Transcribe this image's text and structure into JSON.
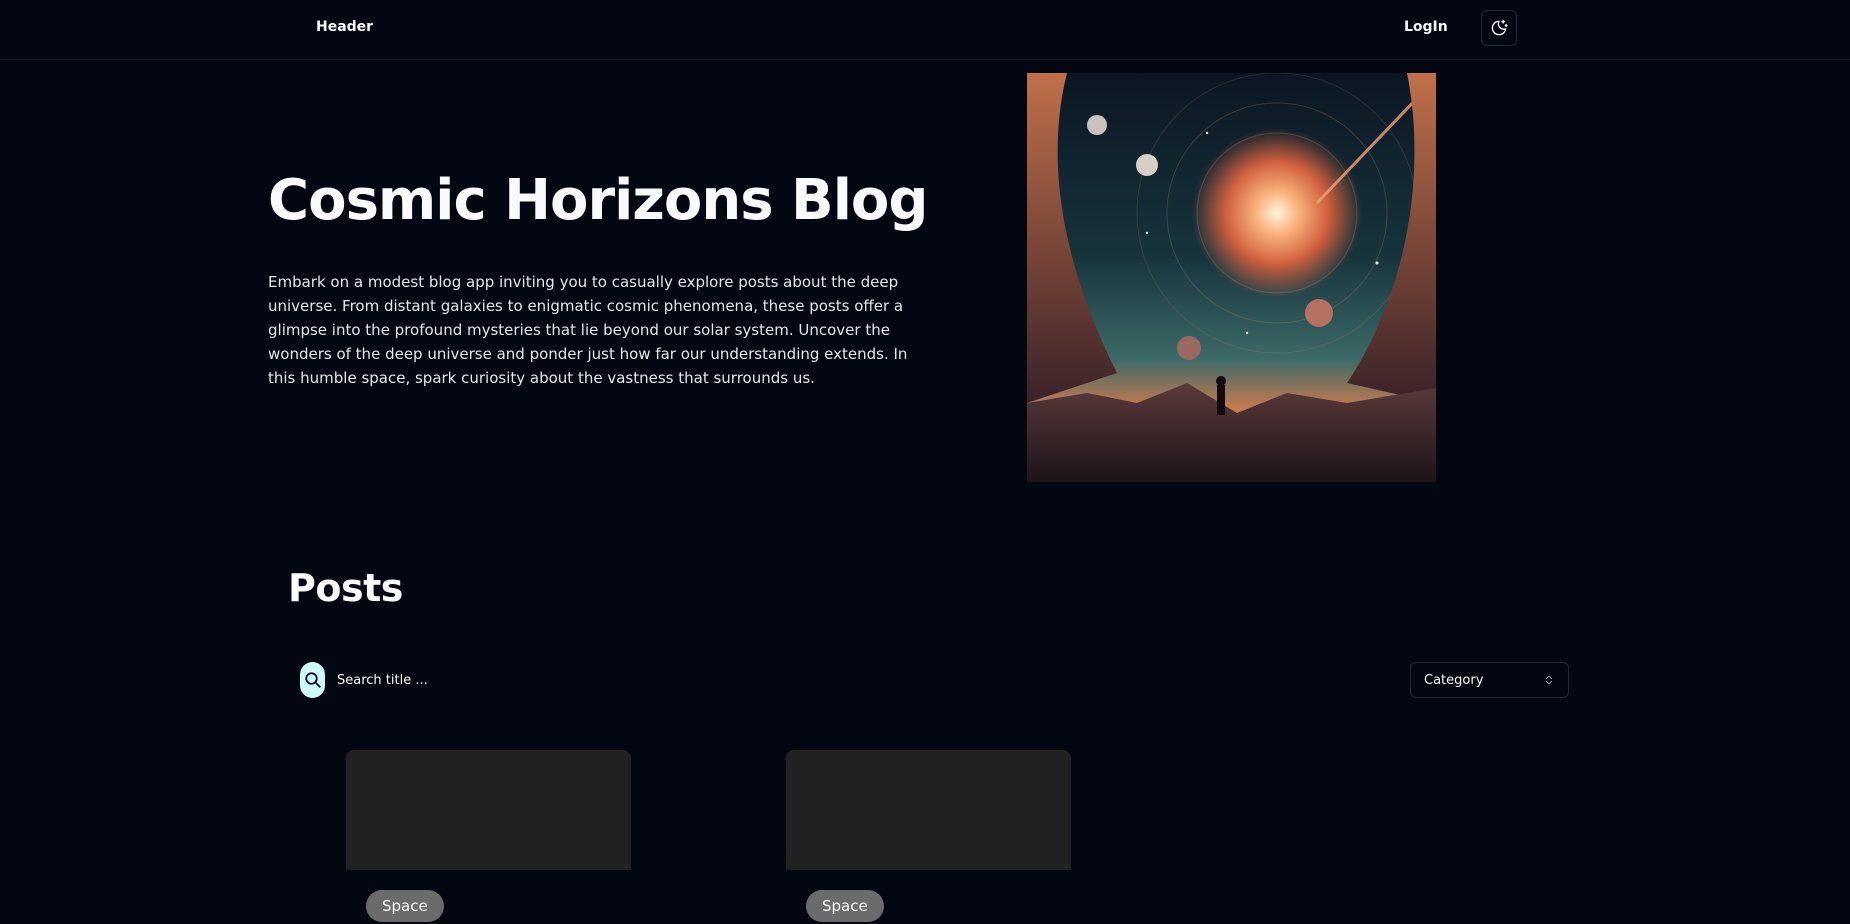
{
  "header": {
    "brand": "Header",
    "login_label": "LogIn",
    "theme_toggle_icon": "moon-stars-icon"
  },
  "hero": {
    "title": "Cosmic Horizons Blog",
    "description": "Embark on a modest blog app inviting you to casually explore posts about the deep universe. From distant galaxies to enigmatic cosmic phenomena, these posts offer a glimpse into the profound mysteries that lie beyond our solar system. Uncover the wonders of the deep universe and ponder just how far our understanding extends. In this humble space, spark curiosity about the vastness that surrounds us."
  },
  "posts": {
    "title": "Posts",
    "search": {
      "placeholder": "Search title ...",
      "value": "",
      "icon": "search-icon"
    },
    "category": {
      "label": "Category",
      "icon": "chevron-up-down-icon"
    },
    "cards": [
      {
        "category": "Space"
      },
      {
        "category": "Space"
      }
    ]
  },
  "colors": {
    "background": "#030712",
    "text": "#f8fafc",
    "border": "#1f2937",
    "search_icon_bg": "#cffafe",
    "badge_bg": "#6b6b6b",
    "card_thumb": "#212121"
  }
}
